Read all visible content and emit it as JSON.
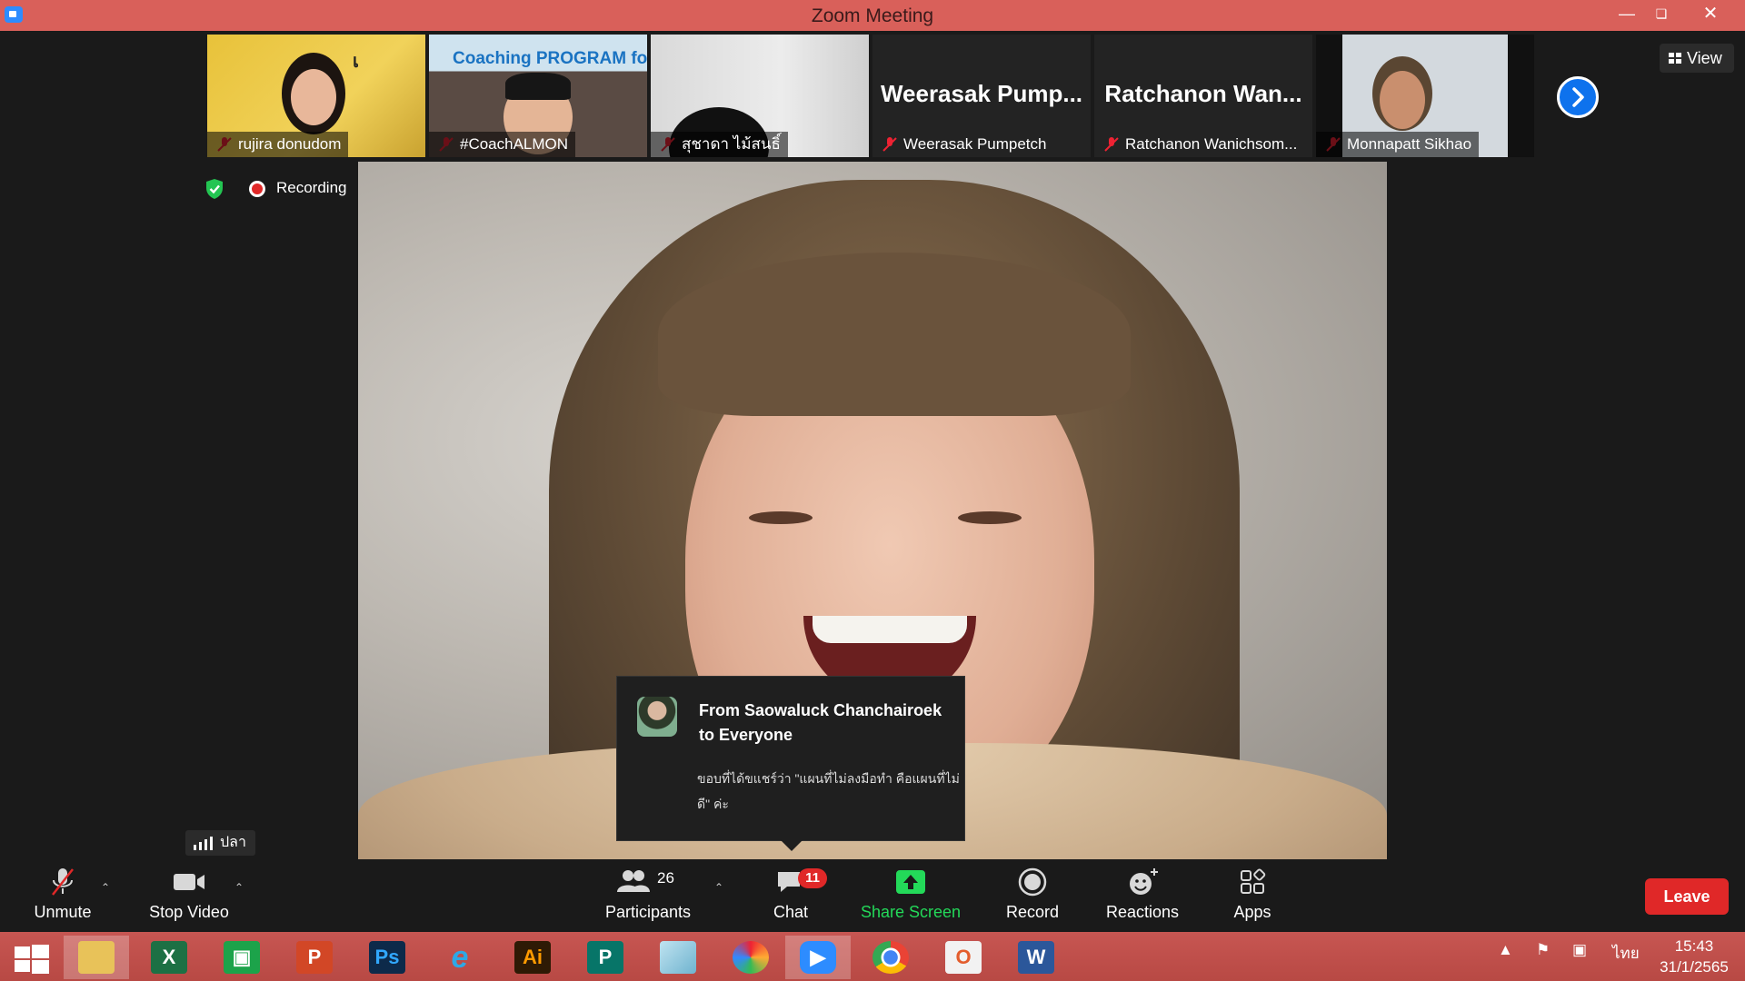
{
  "window": {
    "title": "Zoom Meeting"
  },
  "thumbnails": [
    {
      "name": "rujira donudom",
      "muted": true
    },
    {
      "name": "#CoachALMON",
      "muted": true,
      "overlay_text": "Coaching PROGRAM for ...er"
    },
    {
      "name": "สุชาดา ไม้สนธิ์",
      "muted": true
    },
    {
      "name": "Weerasak Pumpetch",
      "muted": true,
      "big_label": "Weerasak  Pump..."
    },
    {
      "name": "Ratchanon Wanichsom...",
      "muted": true,
      "big_label": "Ratchanon  Wan..."
    },
    {
      "name": "Monnapatt Sikhao",
      "muted": true
    }
  ],
  "view_button": "View",
  "recording": {
    "label": "Recording"
  },
  "chat_toast": {
    "from": "From Saowaluck Chanchairoek to Everyone",
    "message": "ขอบที่ได้ขแชร์ว่า \"แผนที่ไม่ลงมือทำ คือแผนที่ไม่ดี\" ค่ะ"
  },
  "network": {
    "label": "ปลา"
  },
  "toolbar": {
    "unmute": "Unmute",
    "stop_video": "Stop Video",
    "participants": "Participants",
    "participants_count": "26",
    "chat": "Chat",
    "chat_badge": "11",
    "share_screen": "Share Screen",
    "record": "Record",
    "reactions": "Reactions",
    "apps": "Apps",
    "leave": "Leave"
  },
  "taskbar": {
    "language": "ไทย",
    "time": "15:43",
    "date": "31/1/2565",
    "apps": [
      "start",
      "file-explorer",
      "excel",
      "store",
      "powerpoint",
      "photoshop",
      "internet-explorer",
      "illustrator",
      "publisher",
      "notepad",
      "photoscape",
      "zoom",
      "chrome",
      "office",
      "word"
    ]
  },
  "colors": {
    "accent": "#0e72ed",
    "leave": "#e02828",
    "share": "#23d959",
    "titlebar": "#d9605a"
  }
}
